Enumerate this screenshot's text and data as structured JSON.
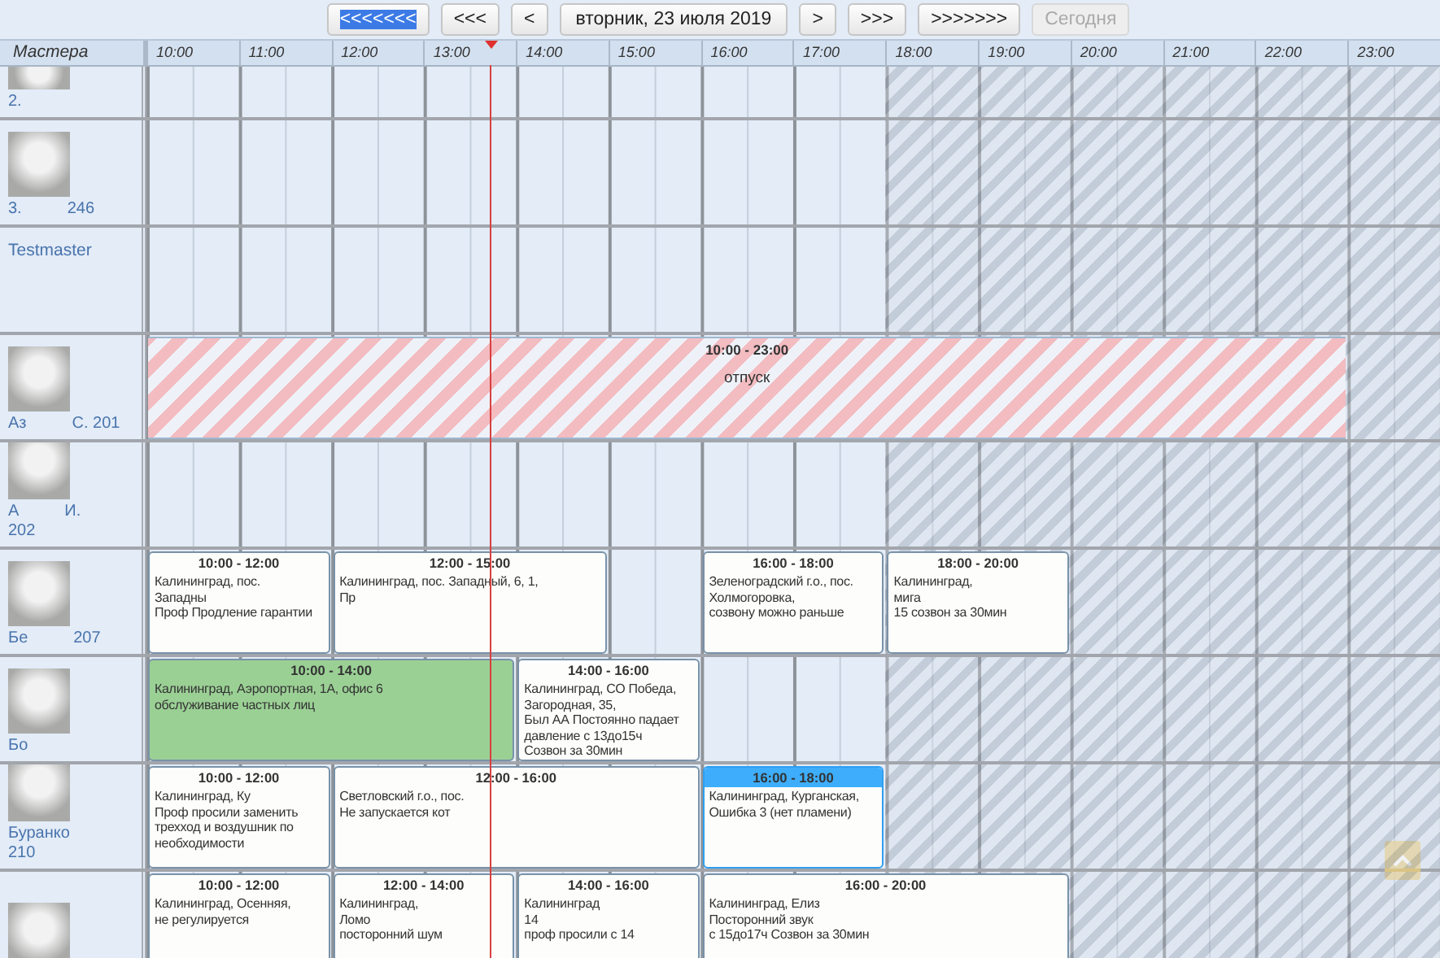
{
  "toolbar": {
    "buttons": [
      {
        "label": "<<<<<<<",
        "kind": "nav",
        "selected": true,
        "disabled": false
      },
      {
        "label": "<<<",
        "kind": "nav",
        "selected": false,
        "disabled": false
      },
      {
        "label": "<",
        "kind": "nav",
        "selected": false,
        "disabled": false
      },
      {
        "label": "вторник, 23 июля 2019",
        "kind": "date",
        "selected": false,
        "disabled": false
      },
      {
        "label": ">",
        "kind": "nav",
        "selected": false,
        "disabled": false
      },
      {
        "label": ">>>",
        "kind": "nav",
        "selected": false,
        "disabled": false
      },
      {
        "label": ">>>>>>>",
        "kind": "nav",
        "selected": false,
        "disabled": false
      },
      {
        "label": "Сегодня",
        "kind": "nav",
        "selected": false,
        "disabled": true
      }
    ]
  },
  "schedule": {
    "masters_header": "Мастера",
    "hours": [
      "10:00",
      "11:00",
      "12:00",
      "13:00",
      "14:00",
      "15:00",
      "16:00",
      "17:00",
      "18:00",
      "19:00",
      "20:00",
      "21:00",
      "22:00",
      "23:00"
    ],
    "rows": [
      {
        "photo": true,
        "name_parts": [
          "2."
        ],
        "events": []
      },
      {
        "photo": true,
        "name_parts": [
          "3.",
          "246"
        ],
        "events": []
      },
      {
        "photo": false,
        "name_parts": [
          "Testmaster"
        ],
        "events": []
      },
      {
        "photo": true,
        "name_parts": [
          "Аз",
          "С. 201"
        ],
        "events": [
          {
            "kind": "absence",
            "time": "10:00 - 23:00",
            "lines": [
              "отпуск"
            ],
            "selected": false
          }
        ]
      },
      {
        "photo": true,
        "name_parts": [
          "А",
          "И.",
          "202"
        ],
        "events": []
      },
      {
        "photo": true,
        "name_parts": [
          "Бе",
          "207"
        ],
        "events": [
          {
            "kind": "visit",
            "time": "10:00 - 12:00",
            "lines": [
              "Калининград, пос.",
              "Западны",
              "Проф Продление гарантии"
            ],
            "selected": false
          },
          {
            "kind": "visit",
            "time": "12:00 - 15:00",
            "lines": [
              "Калининград, пос. Западный, 6, 1,",
              "Пр"
            ],
            "selected": false
          },
          {
            "kind": "visit",
            "time": "16:00 - 18:00",
            "lines": [
              "Зеленоградский г.о., пос.",
              "Холмогоровка,",
              "созвону можно раньше"
            ],
            "selected": false
          },
          {
            "kind": "visit",
            "time": "18:00 - 20:00",
            "lines": [
              "Калининград,",
              "мига",
              "15 созвон за 30мин"
            ],
            "selected": false
          }
        ]
      },
      {
        "photo": true,
        "name_parts": [
          "Бо"
        ],
        "events": [
          {
            "kind": "visit",
            "time": "10:00 - 14:00",
            "lines": [
              "Калининград, Аэропортная, 1А, офис 6",
              "обслуживание частных лиц"
            ],
            "selected": false,
            "color": "#9bd095"
          },
          {
            "kind": "visit",
            "time": "14:00 - 16:00",
            "lines": [
              "Калининград, СО Победа,",
              "Загородная, 35,",
              "Был АА Постоянно падает",
              "давление с 13до15ч",
              "Созвон за 30мин"
            ],
            "selected": false
          }
        ]
      },
      {
        "photo": true,
        "name_parts": [
          "Буранко",
          "210"
        ],
        "events": [
          {
            "kind": "visit",
            "time": "10:00 - 12:00",
            "lines": [
              "Калининград, Ку",
              "Проф просили заменить",
              "трехход и воздушник по",
              "необходимости"
            ],
            "selected": false
          },
          {
            "kind": "visit",
            "time": "12:00 - 16:00",
            "lines": [
              "Светловский г.о., пос.",
              "Не запускается кот"
            ],
            "selected": false
          },
          {
            "kind": "visit",
            "time": "16:00 - 18:00",
            "lines": [
              "Калининград, Курганская,",
              "Ошибка 3 (нет пламени)"
            ],
            "selected": true
          }
        ]
      },
      {
        "photo": true,
        "name_parts": [],
        "events": [
          {
            "kind": "visit",
            "time": "10:00 - 12:00",
            "lines": [
              "Калининград, Осенняя,",
              "не регулируется"
            ],
            "selected": false
          },
          {
            "kind": "visit",
            "time": "12:00 - 14:00",
            "lines": [
              "Калининград,",
              "Ломо",
              "посторонний шум"
            ],
            "selected": false
          },
          {
            "kind": "visit",
            "time": "14:00 - 16:00",
            "lines": [
              "Калининград",
              "14",
              "проф просили с 14"
            ],
            "selected": false
          },
          {
            "kind": "visit",
            "time": "16:00 - 20:00",
            "lines": [
              "Калининград, Елиз",
              "Посторонний звук",
              "с 15до17ч Созвон за 30мин"
            ],
            "selected": false
          }
        ]
      }
    ]
  }
}
